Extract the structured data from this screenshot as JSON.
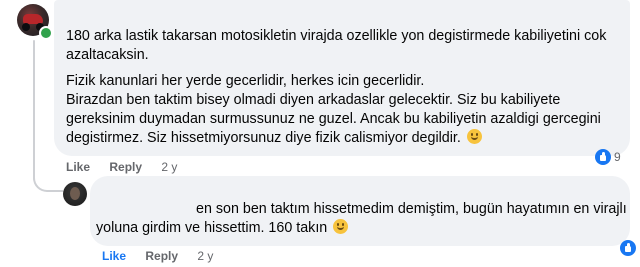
{
  "comment": {
    "paragraph1": [
      "180 arka lastik takarsan motosikletin virajda ozellikle yon degistirmede kabiliyetini cok",
      "azaltacaksin."
    ],
    "paragraph2": [
      "Fizik kanunlari her yerde gecerlidir, herkes icin gecerlidir.",
      "Birazdan ben taktim bisey olmadi diyen arkadaslar gelecektir. Siz bu kabiliyete",
      "gereksinim duymadan surmussunuz ne guzel. Ancak bu kabiliyetin azaldigi gercegini",
      "degistirmez. Siz hissetmiyorsunuz diye fizik calismiyor degildir."
    ],
    "actions": {
      "like": "Like",
      "reply": "Reply",
      "time": "2 y"
    },
    "reaction_count": "9",
    "reaction_icon": "like-icon"
  },
  "reply": {
    "text": [
      "en son ben taktım hissetmedim demiştim, bugün hayatımın en virajlı",
      "yoluna girdim ve hissettim. 160 takın"
    ],
    "actions": {
      "like": "Like",
      "reply": "Reply",
      "time": "2 y"
    },
    "reaction_icon": "like-icon"
  },
  "colors": {
    "bubble": "#f0f2f5",
    "action_text": "#65676b",
    "like_blue": "#1877f2",
    "online": "#31a24c"
  }
}
